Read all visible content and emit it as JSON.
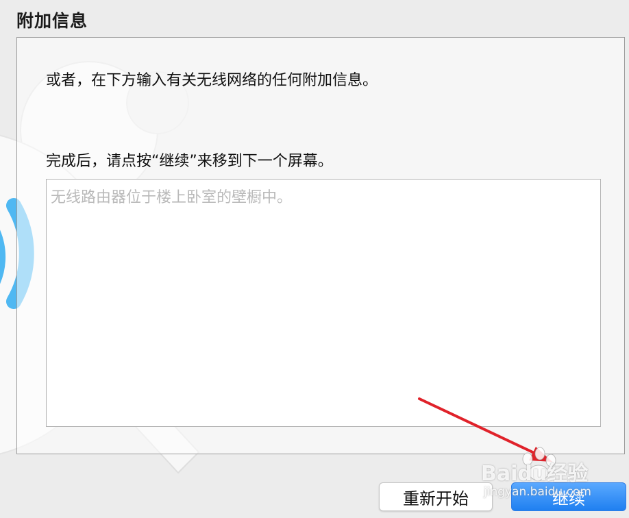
{
  "section": {
    "title": "附加信息"
  },
  "instructions": {
    "line1": "或者，在下方输入有关无线网络的任何附加信息。",
    "line2": "完成后，请点按“继续”来移到下一个屏幕。"
  },
  "notes_field": {
    "placeholder": "无线路由器位于楼上卧室的壁橱中。",
    "value": ""
  },
  "buttons": {
    "restart": "重新开始",
    "continue": "继续"
  },
  "watermark": {
    "brand": "Baidu经验",
    "url": "jingyan.baidu.com"
  },
  "colors": {
    "accent": "#1f7ff0",
    "arrow": "#e0222a",
    "wifi": "#4fb8f2"
  },
  "icons": [
    "wifi-icon",
    "wrench-icon",
    "arrow-annotation"
  ]
}
